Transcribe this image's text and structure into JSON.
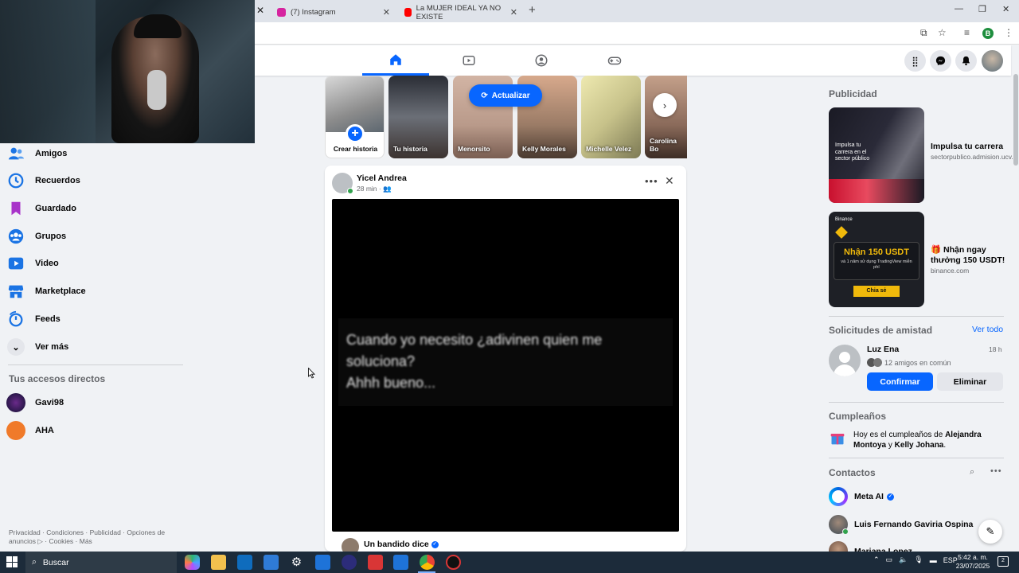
{
  "browser": {
    "tabs": [
      {
        "label": "(7) Instagram",
        "fav_color": "#d6249f"
      },
      {
        "label": "La MUJER IDEAL YA NO EXISTE",
        "fav_color": "#ff0000"
      }
    ],
    "profile_initial": "B"
  },
  "left_nav": {
    "items": [
      {
        "label": "Amigos",
        "icon": "friends-icon"
      },
      {
        "label": "Recuerdos",
        "icon": "memories-icon"
      },
      {
        "label": "Guardado",
        "icon": "saved-icon"
      },
      {
        "label": "Grupos",
        "icon": "groups-icon"
      },
      {
        "label": "Video",
        "icon": "video-icon"
      },
      {
        "label": "Marketplace",
        "icon": "marketplace-icon"
      },
      {
        "label": "Feeds",
        "icon": "feeds-icon"
      },
      {
        "label": "Ver más",
        "icon": "chevron-down-icon"
      }
    ],
    "shortcuts_title": "Tus accesos directos",
    "shortcuts": [
      {
        "label": "Gavi98"
      },
      {
        "label": "AHA"
      }
    ],
    "footer": "Privacidad · Condiciones · Publicidad · Opciones de anuncios ▷ · Cookies · Más"
  },
  "stories": {
    "create_label": "Crear historia",
    "items": [
      {
        "label": "Tu historia",
        "color": "#6b6f77"
      },
      {
        "label": "Menorsito",
        "color": "#b99a8a"
      },
      {
        "label": "Kelly Morales",
        "color": "#9a7b66"
      },
      {
        "label": "Michelle Velez",
        "color": "#c7c28a"
      },
      {
        "label": "Carolina Bo",
        "color": "#8a6a5a"
      }
    ],
    "update_label": "Actualizar"
  },
  "post": {
    "author": "Yicel Andrea",
    "time": "28 min · ",
    "video_text": "Cuando yo necesito ¿adivinen quien me soluciona?\nAhhh bueno...",
    "next_author": "Un bandido dice"
  },
  "right": {
    "ads_title": "Publicidad",
    "ads": [
      {
        "title": "Impulsa tu carrera",
        "url": "sectorpublico.admision.ucv.edu.pe",
        "img_text": "Impulsa tu carrera en el sector público"
      },
      {
        "title": "🎁 Nhận ngay thưởng 150 USDT!",
        "url": "binance.com",
        "img_brand": "Binance",
        "img_headline": "Nhận 150 USDT",
        "img_sub": "và 1 năm sử dụng TradingView miễn phí",
        "img_cta": "Chia sẻ"
      }
    ],
    "friend_requests_title": "Solicitudes de amistad",
    "see_all": "Ver todo",
    "request": {
      "name": "Luz Ena",
      "time": "18 h",
      "mutual": "12 amigos en común",
      "confirm": "Confirmar",
      "delete": "Eliminar"
    },
    "birthdays_title": "Cumpleaños",
    "birthday_text_prefix": "Hoy es el cumpleaños de ",
    "birthday_name1": "Alejandra Montoya",
    "birthday_mid": " y ",
    "birthday_name2": "Kelly Johana",
    "birthday_suffix": ".",
    "contacts_title": "Contactos",
    "contacts": [
      {
        "name": "Meta AI"
      },
      {
        "name": "Luis Fernando Gaviria Ospina"
      },
      {
        "name": "Mariana Lopez"
      }
    ]
  },
  "taskbar": {
    "search_label": "Buscar",
    "lang": "ESP",
    "time": "5:42 a. m.",
    "date": "23/07/2025",
    "notif_count": "2"
  },
  "colors": {
    "fb_blue": "#0866ff",
    "online_green": "#31a24c",
    "taskbar": "#1c2b3a"
  }
}
